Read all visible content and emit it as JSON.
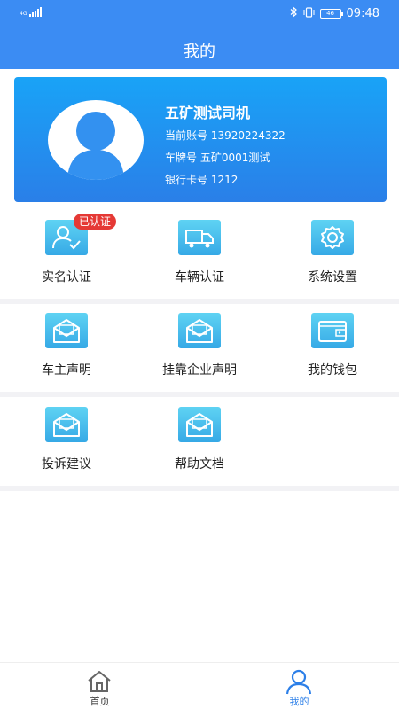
{
  "status_bar": {
    "network": "4G",
    "time": "09:48",
    "battery": "46"
  },
  "header": {
    "title": "我的"
  },
  "profile": {
    "name": "五矿测试司机",
    "account": "当前账号 13920224322",
    "plate": "车牌号 五矿0001测试",
    "bank_card": "银行卡号 1212"
  },
  "menu_rows": [
    [
      {
        "label": "实名认证",
        "icon": "verified-user-icon",
        "badge": "已认证"
      },
      {
        "label": "车辆认证",
        "icon": "truck-icon"
      },
      {
        "label": "系统设置",
        "icon": "gear-icon"
      }
    ],
    [
      {
        "label": "车主声明",
        "icon": "envelope-icon"
      },
      {
        "label": "挂靠企业声明",
        "icon": "envelope-icon"
      },
      {
        "label": "我的钱包",
        "icon": "wallet-icon"
      }
    ],
    [
      {
        "label": "投诉建议",
        "icon": "envelope-icon"
      },
      {
        "label": "帮助文档",
        "icon": "envelope-icon"
      }
    ]
  ],
  "bottom_nav": [
    {
      "label": "首页",
      "icon": "home-icon",
      "active": false
    },
    {
      "label": "我的",
      "icon": "user-icon",
      "active": true
    }
  ],
  "colors": {
    "primary": "#3b8cf3",
    "card_gradient_start": "#19a3f7",
    "card_gradient_end": "#2a7fe8",
    "icon_gradient_start": "#5fd3f3",
    "icon_gradient_end": "#36a9e6",
    "badge": "#e53935",
    "active_nav": "#2c7fe8"
  }
}
